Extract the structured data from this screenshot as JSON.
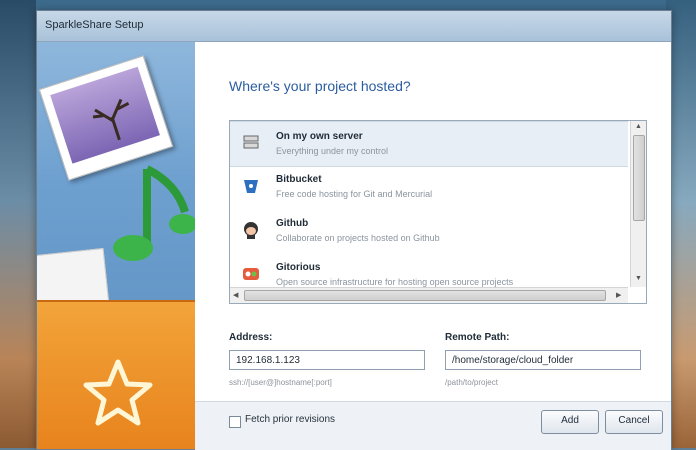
{
  "window": {
    "title": "SparkleShare Setup"
  },
  "main": {
    "heading": "Where's your project hosted?",
    "hosts": [
      {
        "name": "On my own server",
        "description": "Everything under my control",
        "icon": "server-icon"
      },
      {
        "name": "Bitbucket",
        "description": "Free code hosting for Git and Mercurial",
        "icon": "bitbucket-icon"
      },
      {
        "name": "Github",
        "description": "Collaborate on projects hosted on Github",
        "icon": "github-icon"
      },
      {
        "name": "Gitorious",
        "description": "Open source infrastructure for hosting open source projects",
        "icon": "gitorious-icon"
      }
    ],
    "address": {
      "label": "Address:",
      "value": "192.168.1.123",
      "hint": "ssh://[user@]hostname[:port]"
    },
    "remote_path": {
      "label": "Remote Path:",
      "value": "/home/storage/cloud_folder",
      "hint": "/path/to/project"
    }
  },
  "footer": {
    "fetch_label": "Fetch prior revisions",
    "add_label": "Add",
    "cancel_label": "Cancel"
  },
  "colors": {
    "heading": "#2b5da0",
    "sidebar": "#6d9fcf",
    "folder": "#e7801a"
  }
}
